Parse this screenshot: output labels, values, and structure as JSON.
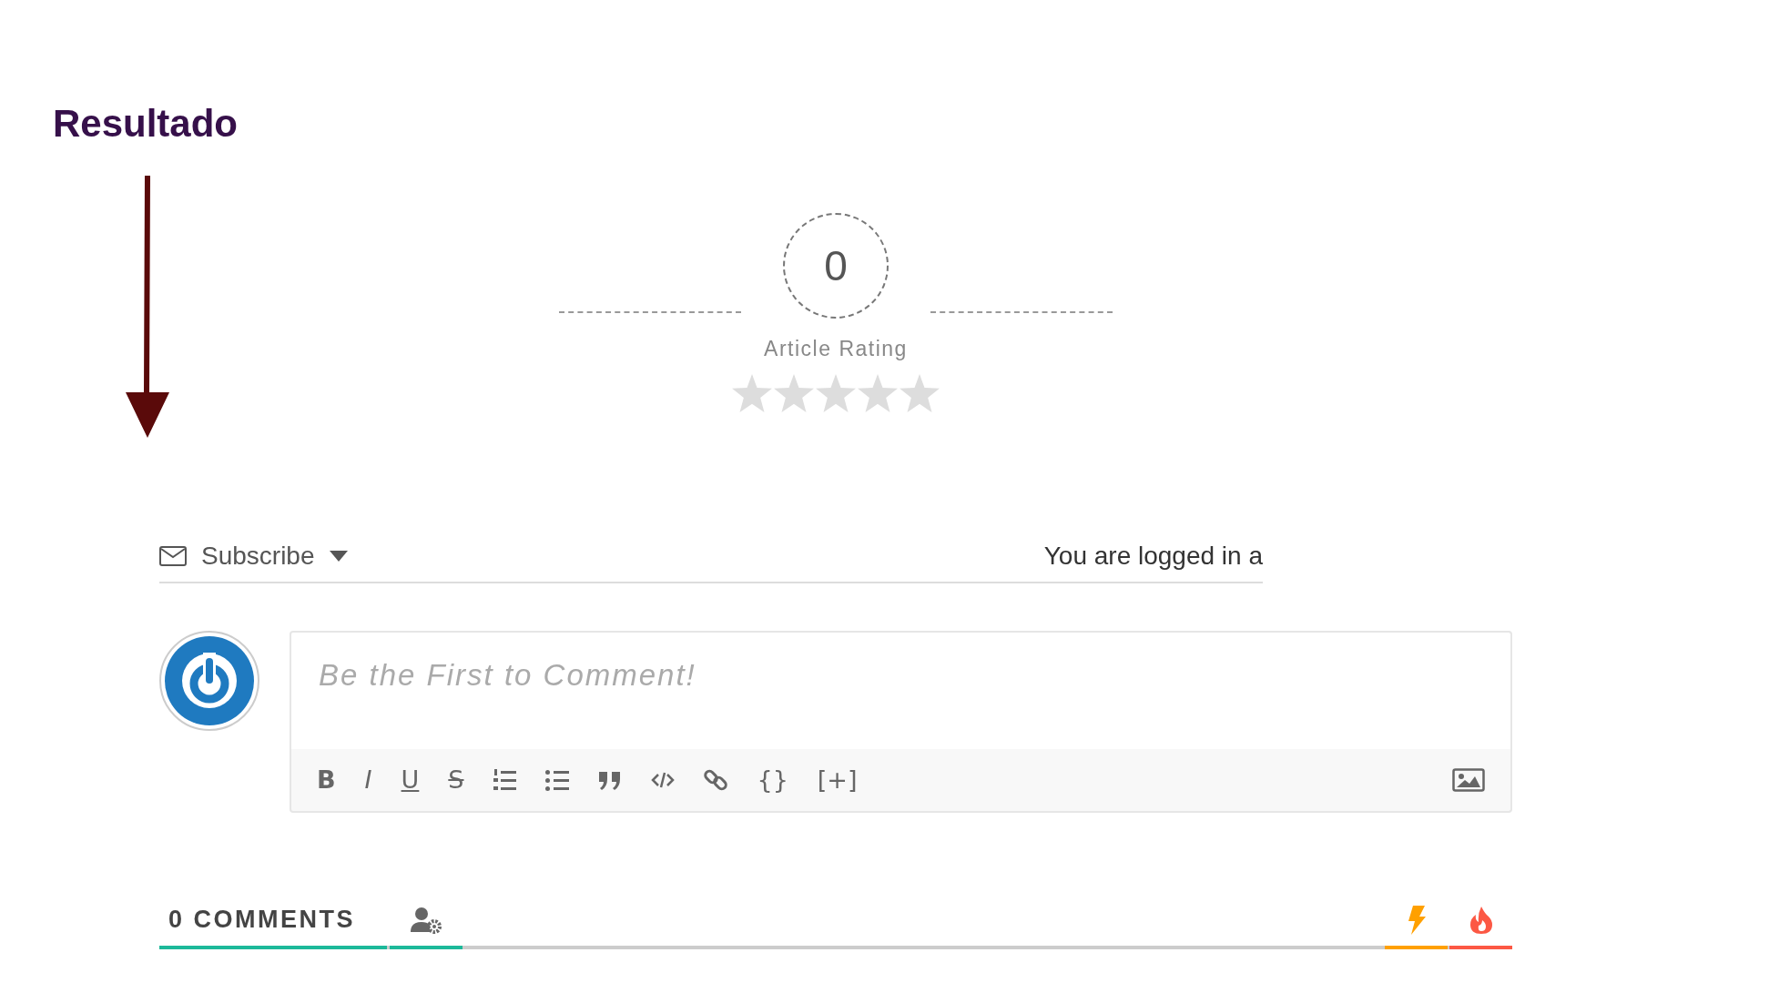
{
  "annotation": {
    "title": "Resultado"
  },
  "rating": {
    "value": "0",
    "label": "Article Rating",
    "stars": 0
  },
  "subscribe": {
    "label": "Subscribe",
    "login_text": "You are logged in a"
  },
  "comment_form": {
    "placeholder": "Be the First to Comment!",
    "toolbar": [
      {
        "kind": "bold",
        "label": "B"
      },
      {
        "kind": "italic",
        "label": "I"
      },
      {
        "kind": "underline",
        "label": "U"
      },
      {
        "kind": "strike",
        "label": "S"
      },
      {
        "kind": "ordered-list"
      },
      {
        "kind": "bullet-list"
      },
      {
        "kind": "quote"
      },
      {
        "kind": "code"
      },
      {
        "kind": "link"
      },
      {
        "kind": "code-block",
        "label": "{}"
      },
      {
        "kind": "spoiler",
        "label": "[+]"
      }
    ]
  },
  "comments_bar": {
    "count_label": "0 COMMENTS",
    "filters": [
      {
        "kind": "user-settings",
        "color": "#1db99a"
      },
      {
        "kind": "newest",
        "color": "#ffa000"
      },
      {
        "kind": "hottest",
        "color": "#fc5844"
      }
    ]
  }
}
